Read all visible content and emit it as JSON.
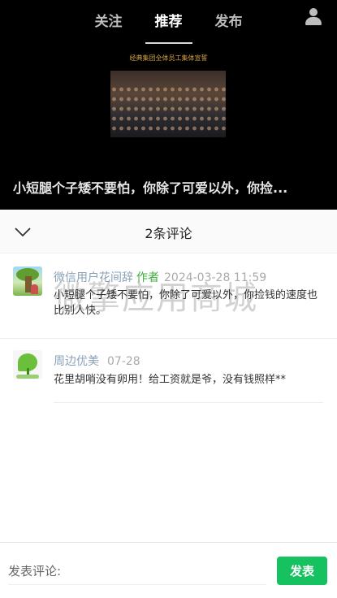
{
  "nav": {
    "tabs": [
      {
        "label": "关注"
      },
      {
        "label": "推荐"
      },
      {
        "label": "发布"
      }
    ],
    "active_tab": "推荐",
    "user_icon": "user-icon"
  },
  "video": {
    "caption": "经典集团全体员工集体宣誓",
    "title": "小短腿个子矮不要怕，你除了可爱以外，你捡..."
  },
  "comments_panel": {
    "title": "2条评论",
    "collapse_icon": "chevron-down-icon"
  },
  "comments": [
    {
      "name": "微信用户花间辞",
      "author_tag": "作者",
      "time": "2024-03-28 11:59",
      "text": "小短腿个子矮不要怕，你除了可爱以外，你捡钱的速度也比别人快。"
    },
    {
      "name": "周边优美",
      "time": "07-28",
      "text": "花里胡哨没有卵用！给工资就是爷，没有钱照样**"
    }
  ],
  "watermark": "微擎应用商城",
  "input_bar": {
    "placeholder": "发表评论:",
    "value": "",
    "send_label": "发表"
  },
  "colors": {
    "accent": "#16c160",
    "author_tag": "#3daf3a",
    "username": "#8aa0b8"
  }
}
